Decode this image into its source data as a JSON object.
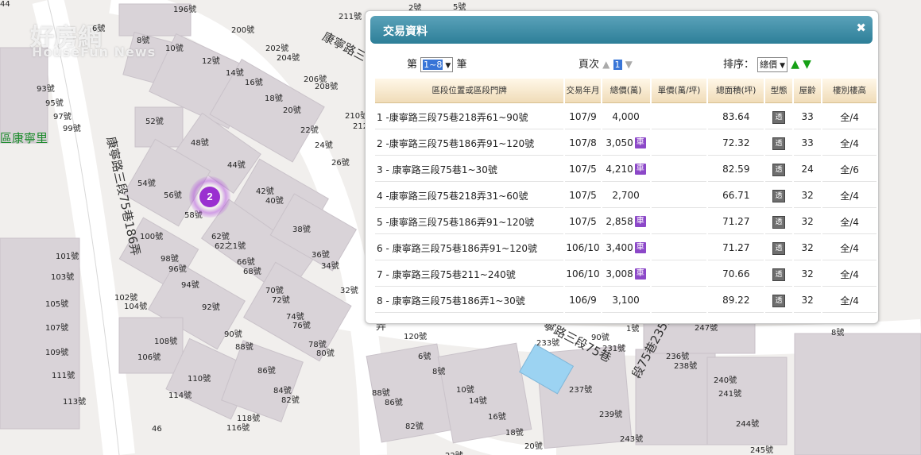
{
  "map": {
    "watermark_cn": "好房網",
    "watermark_en": "HouseFun News",
    "district": "區康寧里",
    "cluster_count": "2",
    "streets": {
      "kangning_lane186": "康寧路三段75巷186弄",
      "kangning_top": "康寧路三",
      "kangning_bottom": "寧路三段75巷",
      "lane235": "段75巷235弄",
      "fragment_bottom_left": "弄"
    },
    "house_numbers": [
      "196號",
      "6號",
      "8號",
      "10號",
      "12號",
      "14號",
      "16號",
      "18號",
      "20號",
      "22號",
      "24號",
      "26號",
      "200號",
      "202號",
      "204號",
      "206號",
      "208號",
      "210號",
      "211號",
      "212號",
      "93號",
      "95號",
      "97號",
      "99號",
      "52號",
      "48號",
      "44號",
      "54號",
      "56號",
      "58號",
      "42號",
      "40號",
      "38號",
      "36號",
      "34號",
      "32號",
      "62號",
      "62之1號",
      "66號",
      "68號",
      "70號",
      "72號",
      "74號",
      "76號",
      "78號",
      "80號",
      "100號",
      "98號",
      "96號",
      "94號",
      "92號",
      "90號",
      "88號",
      "86號",
      "84號",
      "82號",
      "101號",
      "103號",
      "105號",
      "107號",
      "109號",
      "111號",
      "113號",
      "102號",
      "104號",
      "106號",
      "108號",
      "110號",
      "114號",
      "116號",
      "118號",
      "120號",
      "6號",
      "8號",
      "10號",
      "14號",
      "16號",
      "18號",
      "20號",
      "22號",
      "82號",
      "86號",
      "88號",
      "90號",
      "231號",
      "233號",
      "236號",
      "237號",
      "238號",
      "239號",
      "240號",
      "241號",
      "243號",
      "244號",
      "245號",
      "247號",
      "1號",
      "2號",
      "5號",
      "8號",
      "46",
      "44"
    ]
  },
  "panel": {
    "title": "交易資料",
    "close": "✖",
    "count_prefix": "第",
    "count_value": "1~8",
    "count_suffix": "筆",
    "page_label": "頁次",
    "page_value": "1",
    "sort_label": "排序：",
    "sort_value": "總價",
    "headers": [
      "區段位置或區段門牌",
      "交易年月",
      "總價(萬)",
      "單價(萬/坪)",
      "總面積(坪)",
      "型態",
      "屋齡",
      "樓別樓高"
    ],
    "rows": [
      {
        "addr": "1 -康寧路三段75巷218弄61~90號",
        "ym": "107/9",
        "price": "4,000",
        "car": false,
        "unit": "",
        "area": "83.64",
        "age": "33",
        "floor": "全/4"
      },
      {
        "addr": "2 -康寧路三段75巷186弄91~120號",
        "ym": "107/8",
        "price": "3,050",
        "car": true,
        "unit": "",
        "area": "72.32",
        "age": "33",
        "floor": "全/4"
      },
      {
        "addr": "3 - 康寧路三段75巷1~30號",
        "ym": "107/5",
        "price": "4,210",
        "car": true,
        "unit": "",
        "area": "82.59",
        "age": "24",
        "floor": "全/6"
      },
      {
        "addr": "4 -康寧路三段75巷218弄31~60號",
        "ym": "107/5",
        "price": "2,700",
        "car": false,
        "unit": "",
        "area": "66.71",
        "age": "32",
        "floor": "全/4"
      },
      {
        "addr": "5 -康寧路三段75巷186弄91~120號",
        "ym": "107/5",
        "price": "2,858",
        "car": true,
        "unit": "",
        "area": "71.27",
        "age": "32",
        "floor": "全/4"
      },
      {
        "addr": "6 - 康寧路三段75巷186弄91~120號",
        "ym": "106/10",
        "price": "3,400",
        "car": true,
        "unit": "",
        "area": "71.27",
        "age": "32",
        "floor": "全/4"
      },
      {
        "addr": "7 - 康寧路三段75巷211~240號",
        "ym": "106/10",
        "price": "3,008",
        "car": true,
        "unit": "",
        "area": "70.66",
        "age": "32",
        "floor": "全/4"
      },
      {
        "addr": "8 - 康寧路三段75巷186弄1~30號",
        "ym": "106/9",
        "price": "3,100",
        "car": false,
        "unit": "",
        "area": "89.22",
        "age": "32",
        "floor": "全/4"
      }
    ],
    "car_label": "車",
    "type_label": "透"
  },
  "colors": {
    "header": "#3a8fa8",
    "car": "#8c48c8",
    "cluster": "#9a2fd0",
    "district": "#1a8a2a",
    "sort_arrow": "#16a016"
  }
}
